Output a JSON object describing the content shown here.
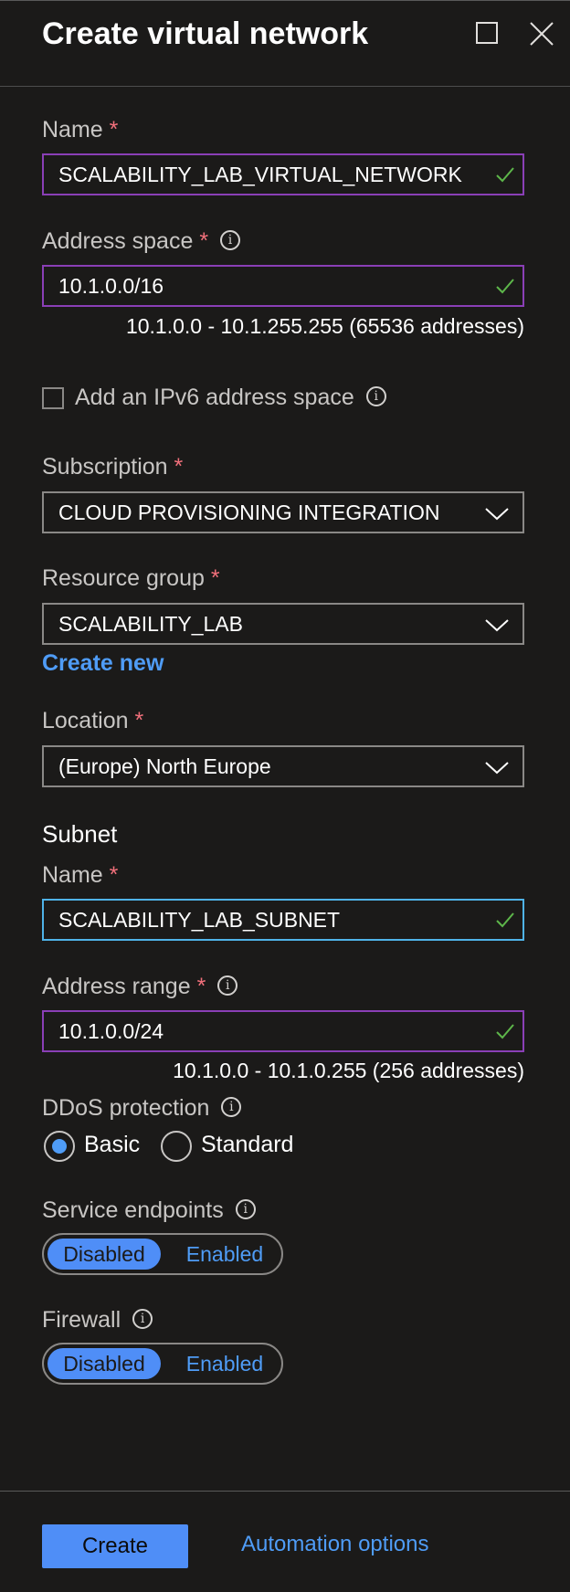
{
  "header": {
    "title": "Create virtual network"
  },
  "network": {
    "name_label": "Name",
    "name_value": "SCALABILITY_LAB_VIRTUAL_NETWORK",
    "address_space_label": "Address space",
    "address_space_value": "10.1.0.0/16",
    "address_space_hint": "10.1.0.0 - 10.1.255.255 (65536 addresses)",
    "ipv6_label": "Add an IPv6 address space",
    "ipv6_checked": false
  },
  "subscription": {
    "label": "Subscription",
    "value": "CLOUD PROVISIONING INTEGRATION"
  },
  "resource_group": {
    "label": "Resource group",
    "value": "SCALABILITY_LAB",
    "create_new": "Create new"
  },
  "location": {
    "label": "Location",
    "value": "(Europe) North Europe"
  },
  "subnet": {
    "section_title": "Subnet",
    "name_label": "Name",
    "name_value": "SCALABILITY_LAB_SUBNET",
    "range_label": "Address range",
    "range_value": "10.1.0.0/24",
    "range_hint": "10.1.0.0 - 10.1.0.255 (256 addresses)"
  },
  "ddos": {
    "label": "DDoS protection",
    "options": [
      "Basic",
      "Standard"
    ],
    "selected": "Basic"
  },
  "service_endpoints": {
    "label": "Service endpoints",
    "options": [
      "Disabled",
      "Enabled"
    ],
    "selected": "Disabled"
  },
  "firewall": {
    "label": "Firewall",
    "options": [
      "Disabled",
      "Enabled"
    ],
    "selected": "Disabled"
  },
  "footer": {
    "create_label": "Create",
    "automation_label": "Automation options"
  },
  "colors": {
    "accent": "#4f8ef7",
    "link": "#4f9cf6",
    "required": "#f1707b",
    "valid_border": "#8a3fb6",
    "focus_border": "#4fb3e8",
    "check": "#5db64a"
  },
  "icons": {
    "required": "*",
    "info": "i"
  }
}
